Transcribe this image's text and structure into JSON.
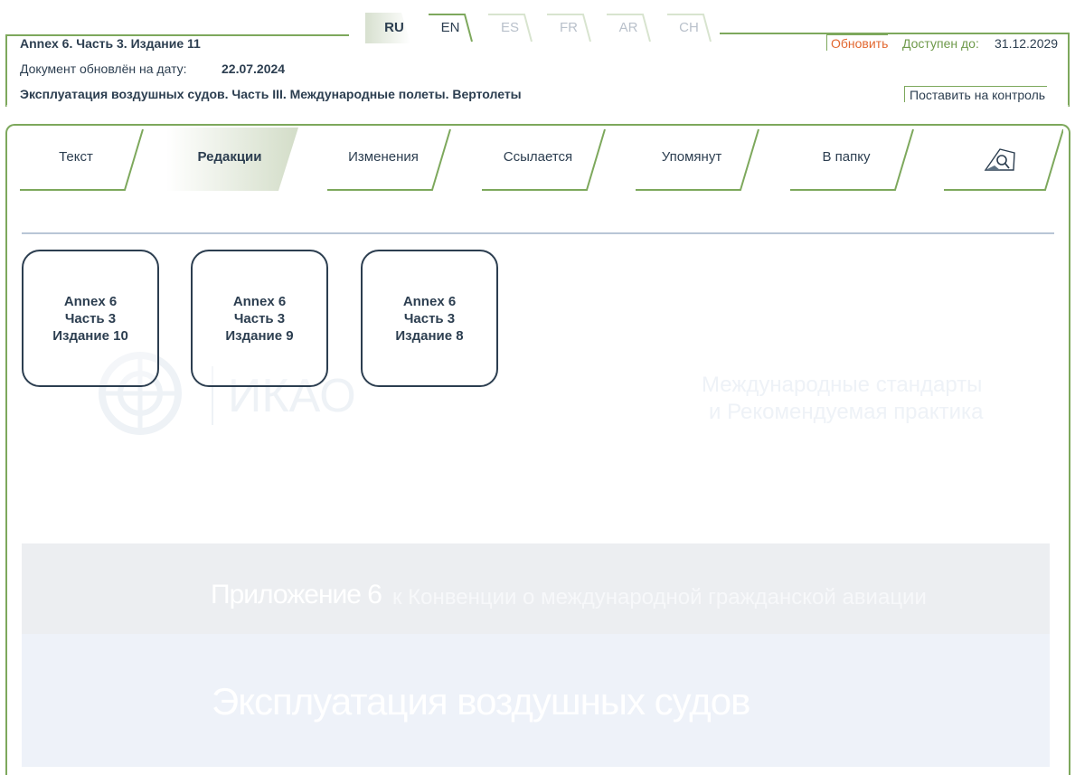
{
  "languages": [
    {
      "code": "RU",
      "state": "active"
    },
    {
      "code": "EN",
      "state": "available"
    },
    {
      "code": "ES",
      "state": "disabled"
    },
    {
      "code": "FR",
      "state": "disabled"
    },
    {
      "code": "AR",
      "state": "disabled"
    },
    {
      "code": "CH",
      "state": "disabled"
    }
  ],
  "header": {
    "doc_title": "Annex 6. Часть 3. Издание 11",
    "updated_label": "Документ обновлён на дату:",
    "updated_value": "22.07.2024",
    "doc_subtitle": "Эксплуатация воздушных судов. Часть III. Международные полеты. Вертолеты",
    "update_button": "Обновить",
    "available_label": "Доступен до:",
    "available_value": "31.12.2029",
    "watch_button": "Поставить на контроль"
  },
  "tabs": [
    {
      "label": "Текст",
      "active": false
    },
    {
      "label": "Редакции",
      "active": true
    },
    {
      "label": "Изменения",
      "active": false
    },
    {
      "label": "Ссылается",
      "active": false
    },
    {
      "label": "Упомянут",
      "active": false
    },
    {
      "label": "В папку",
      "active": false
    },
    {
      "label": "",
      "icon": "search-document-icon",
      "active": false
    }
  ],
  "editions": [
    {
      "line1": "Annex 6",
      "line2": "Часть 3",
      "line3": "Издание 10"
    },
    {
      "line1": "Annex 6",
      "line2": "Часть 3",
      "line3": "Издание 9"
    },
    {
      "line1": "Annex 6",
      "line2": "Часть 3",
      "line3": "Издание 8"
    }
  ],
  "background": {
    "logo_text": "ИКАО",
    "right_line1": "Международные стандарты",
    "right_line2": "и Рекомендуемая практика",
    "band_title": "Приложение 6",
    "band_subtitle": "к Конвенции о международной гражданской авиации",
    "band_heading": "Эксплуатация воздушных судов"
  },
  "colors": {
    "accent_green": "#7da85c",
    "text_dark": "#2c3e50",
    "update_orange": "#e2672f",
    "card_border": "#2c3e50"
  }
}
